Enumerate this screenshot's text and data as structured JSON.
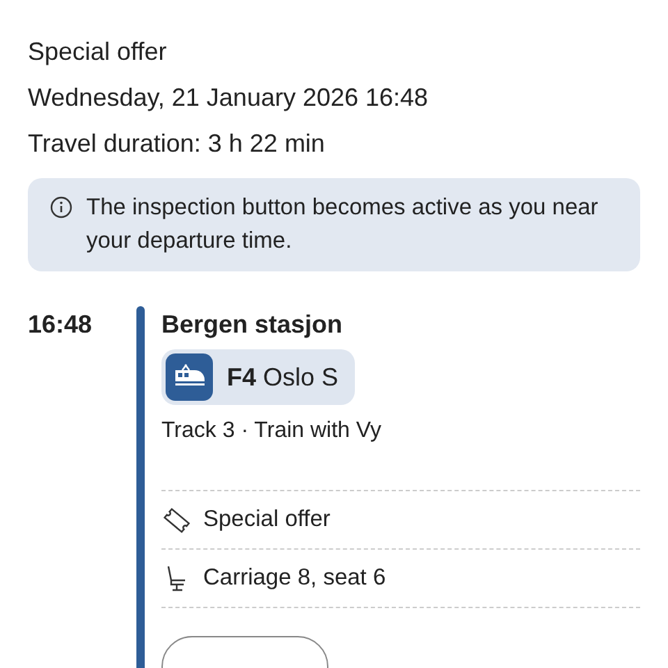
{
  "summary": [
    "Special offer",
    "Wednesday, 21 January 2026 16:48",
    "Travel duration: 3 h 22 min"
  ],
  "notice": {
    "text": "The inspection button becomes active as you near your departure time."
  },
  "departure": {
    "time": "16:48",
    "station": "Bergen stasjon",
    "line": "F4",
    "destination": "Oslo S",
    "details": "Track 3 · Train with Vy"
  },
  "features": [
    {
      "kind": "ticket",
      "text": "Special offer"
    },
    {
      "kind": "seat",
      "text": "Carriage 8, seat 6"
    }
  ]
}
